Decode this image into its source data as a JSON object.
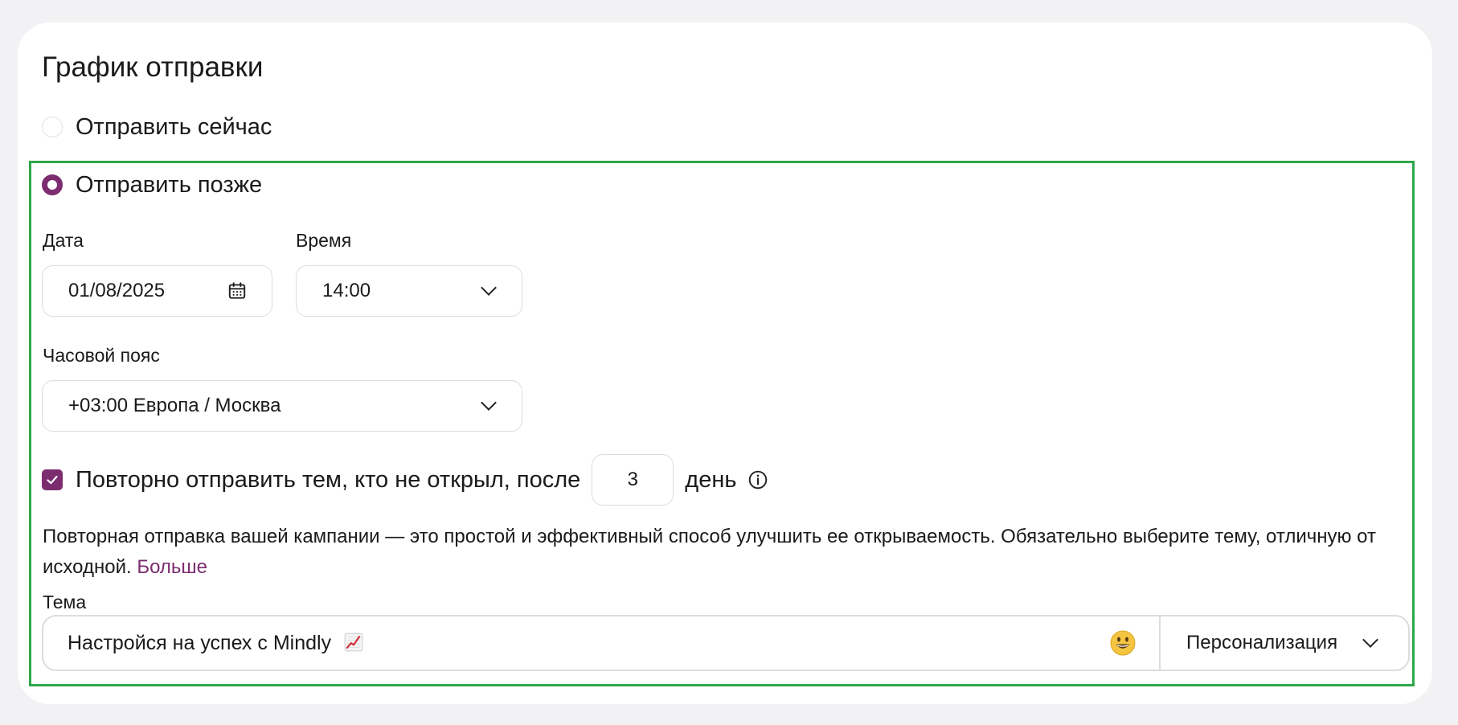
{
  "section": {
    "title": "График отправки"
  },
  "schedule": {
    "send_now_label": "Отправить сейчас",
    "send_later_label": "Отправить позже",
    "selected": "send_later"
  },
  "date": {
    "label": "Дата",
    "value": "01/08/2025"
  },
  "time": {
    "label": "Время",
    "value": "14:00"
  },
  "timezone": {
    "label": "Часовой пояс",
    "value": "+03:00 Европа / Москва"
  },
  "resend": {
    "checked": true,
    "label_before": "Повторно отправить тем, кто не открыл, после",
    "days_value": "3",
    "label_after": "день"
  },
  "help": {
    "text": "Повторная отправка вашей кампании — это простой и эффективный способ улучшить ее открываемость. Обязательно выберите тему, отличную от исходной.",
    "link_label": "Больше"
  },
  "subject": {
    "label": "Тема",
    "value": "Настройся на успех с Mindly",
    "emoji_icon": "chart-increasing-icon",
    "personalize_label": "Персонализация"
  },
  "colors": {
    "accent": "#7b2d70",
    "highlight_border": "#2ea84b"
  }
}
